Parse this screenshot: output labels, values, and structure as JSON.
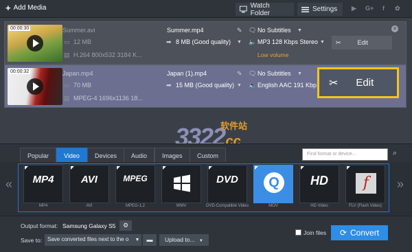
{
  "toolbar": {
    "add_media": "Add Media",
    "watch_folder": "Watch Folder",
    "settings": "Settings",
    "social": [
      "YouTube",
      "G+",
      "f",
      "VK"
    ]
  },
  "files": [
    {
      "duration": "00:00:30",
      "name": "Summer.avi",
      "size": "12 MB",
      "info": "H.264 800x532 3184 K...",
      "output_name": "Summer.mp4",
      "output_size": "8 MB (Good quality)",
      "subtitles": "No Subtitles",
      "audio": "MP3 128 Kbps Stereo",
      "warning": "Low volume",
      "edit_label": "Edit"
    },
    {
      "duration": "00:00:32",
      "name": "Japan.mp4",
      "size": "70 MB",
      "info": "MPEG-4 1696x1136 18...",
      "output_name": "Japan (1).mp4",
      "output_size": "15 MB (Good quality)",
      "subtitles": "No Subtitles",
      "audio": "English AAC 191 Kbp...",
      "edit_label": "Edit"
    }
  ],
  "watermark": {
    "number": "3322",
    "suffix": ".cc",
    "cn": "软件站"
  },
  "tabs": [
    "Popular",
    "Video",
    "Devices",
    "Audio",
    "Images",
    "Custom"
  ],
  "active_tab": "Video",
  "format_search": {
    "placeholder": "Find format or device..."
  },
  "formats": [
    {
      "tile": "MP4",
      "label": "MP4"
    },
    {
      "tile": "AVI",
      "label": "AVI"
    },
    {
      "tile": "MPEG",
      "label": "MPEG-1,2"
    },
    {
      "tile": "",
      "label": "WMV"
    },
    {
      "tile": "DVD",
      "label": "DVD-Compatible Video"
    },
    {
      "tile": "Q",
      "label": "MOV"
    },
    {
      "tile": "HD",
      "label": "HD Video"
    },
    {
      "tile": "f",
      "label": "FLV (Flash Video)"
    }
  ],
  "selected_format": "MOV",
  "footer": {
    "output_format_label": "Output format:",
    "output_format_value": "Samsung Galaxy S5",
    "save_to_label": "Save to:",
    "save_to_value": "Save converted files next to the o",
    "upload_label": "Upload to...",
    "join_files_label": "Join files",
    "convert_label": "Convert"
  },
  "colors": {
    "accent": "#2e8de6",
    "highlight": "#f5c518",
    "warning": "#e9a33b"
  }
}
